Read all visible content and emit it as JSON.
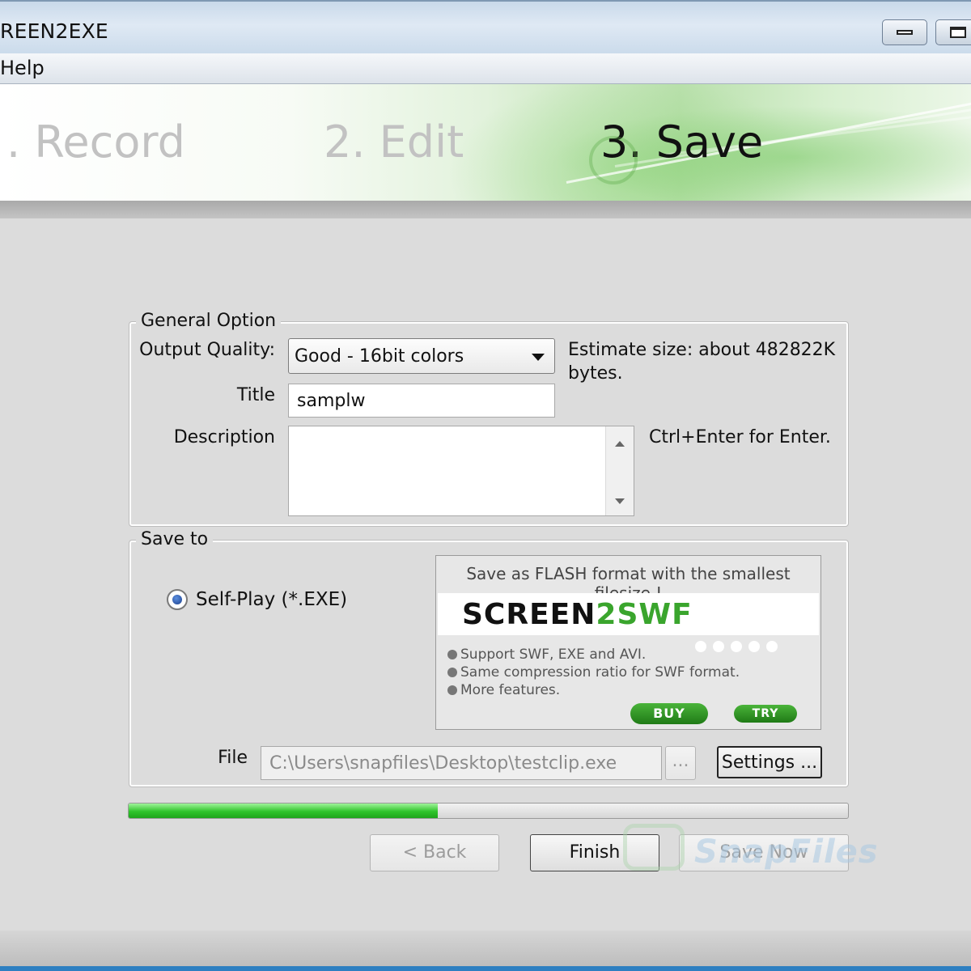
{
  "window": {
    "title": "REEN2EXE",
    "menu": [
      "Help"
    ]
  },
  "banner": {
    "steps": [
      {
        "label": ". Record",
        "active": false
      },
      {
        "label": "2. Edit",
        "active": false
      },
      {
        "label": "3. Save",
        "active": true
      }
    ]
  },
  "general": {
    "legend": "General Option",
    "quality_label": "Output Quality:",
    "quality_value": "Good - 16bit colors",
    "estimate_line1": "Estimate size: about 482822K",
    "estimate_line2": "bytes.",
    "title_label": "Title",
    "title_value": "samplw",
    "description_label": "Description",
    "description_value": "",
    "description_hint": "Ctrl+Enter for Enter."
  },
  "save_to": {
    "legend": "Save to",
    "radio_label": "Self-Play (*.EXE)",
    "radio_checked": true,
    "file_label": "File",
    "file_value": "C:\\Users\\snapfiles\\Desktop\\testclip.exe",
    "browse_label": "...",
    "settings_label": "Settings ..."
  },
  "promo": {
    "headline": "Save as FLASH format with the smallest filesize !",
    "logo_left": "SCREEN",
    "logo_mid": "2",
    "logo_right": "SWF",
    "features": [
      "Support SWF, EXE and AVI.",
      "Same compression ratio for SWF format.",
      "More features."
    ],
    "buy_label": "BUY",
    "try_label": "TRY"
  },
  "progress": {
    "percent": 43
  },
  "buttons": {
    "back": "< Back",
    "finish": "Finish",
    "save_now": "Save Now"
  },
  "watermark": "SnapFiles",
  "colors": {
    "progress_green": "#2fc42b",
    "accent_green": "#3aa52d",
    "taskbar_blue": "#2d7fc1"
  }
}
